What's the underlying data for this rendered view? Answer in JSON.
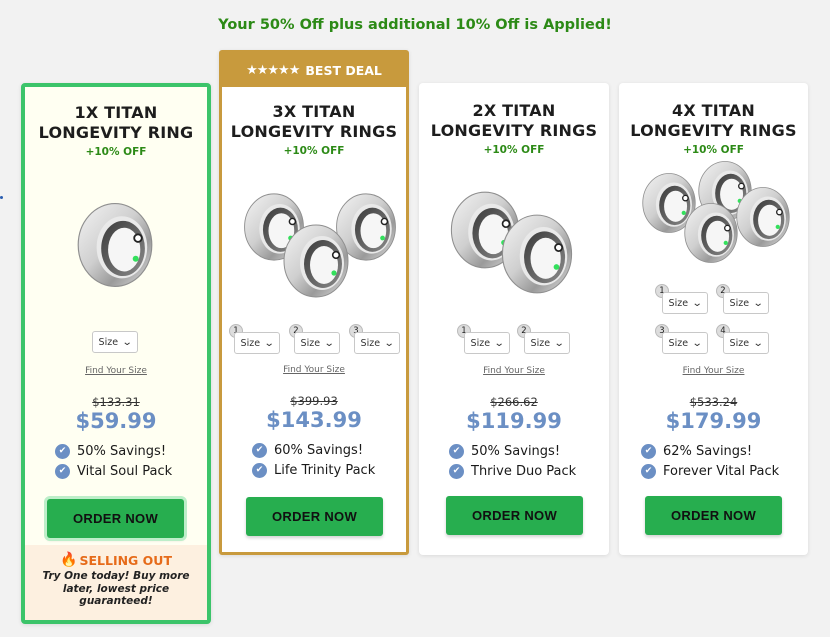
{
  "banner": "Your 50% Off plus additional 10% Off is Applied!",
  "colors": {
    "accent_green": "#2c8a16",
    "price_blue": "#6b8fc4",
    "order_green": "#27ae4f",
    "gold": "#c89a3d",
    "selected_border": "#3cc46a"
  },
  "size_label": "Size",
  "find_size": "Find Your Size",
  "order_label": "ORDER NOW",
  "best_deal": {
    "stars": "★★★★★",
    "label": "BEST DEAL"
  },
  "selling_out": {
    "header": "SELLING OUT",
    "message": "Try One today! Buy more later, lowest price guaranteed!",
    "icon": "flame-icon"
  },
  "cards": [
    {
      "title1": "1X TITAN",
      "title2": "LONGEVITY RING",
      "off": "+10% OFF",
      "old_price": "$133.31",
      "price": "$59.99",
      "perks": [
        "50% Savings!",
        "Vital Soul Pack"
      ],
      "selected": true
    },
    {
      "title1": "3X TITAN",
      "title2": "LONGEVITY RINGS",
      "off": "+10% OFF",
      "old_price": "$399.93",
      "price": "$143.99",
      "perks": [
        "60% Savings!",
        "Life Trinity Pack"
      ],
      "sizes": [
        "1",
        "2",
        "3"
      ]
    },
    {
      "title1": "2X TITAN",
      "title2": "LONGEVITY RINGS",
      "off": "+10% OFF",
      "old_price": "$266.62",
      "price": "$119.99",
      "perks": [
        "50% Savings!",
        "Thrive Duo Pack"
      ],
      "sizes": [
        "1",
        "2"
      ]
    },
    {
      "title1": "4X TITAN",
      "title2": "LONGEVITY RINGS",
      "off": "+10% OFF",
      "old_price": "$533.24",
      "price": "$179.99",
      "perks": [
        "62% Savings!",
        "Forever Vital Pack"
      ],
      "sizes": [
        "1",
        "2",
        "3",
        "4"
      ]
    }
  ]
}
